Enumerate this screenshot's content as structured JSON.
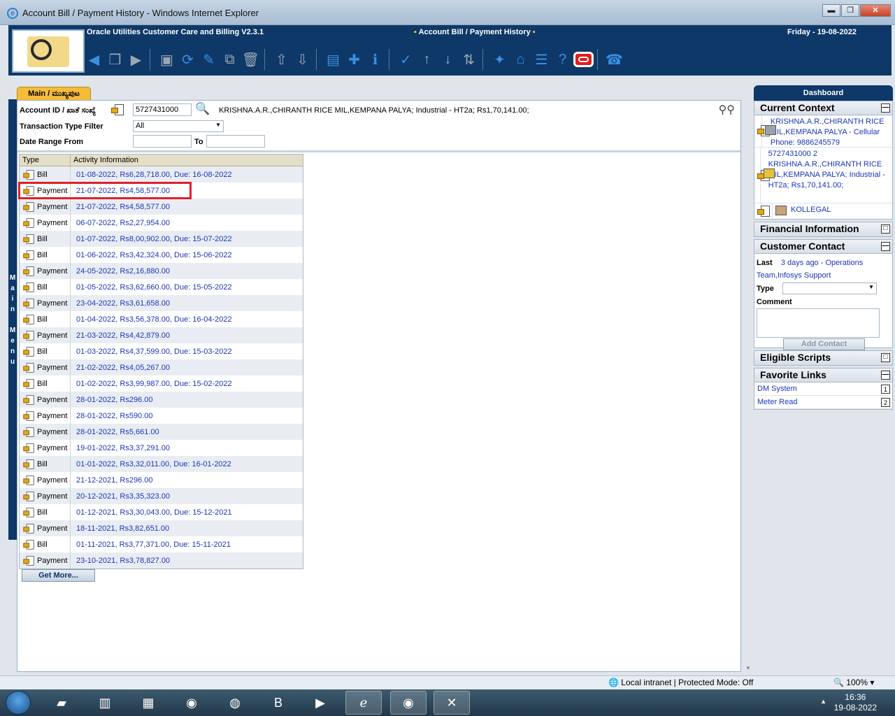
{
  "window": {
    "title": "Account Bill / Payment History - Windows Internet Explorer",
    "min": "▬",
    "max": "❐",
    "close": "✕"
  },
  "header": {
    "app_name": "Oracle Utilities Customer Care and Billing V2.3.1",
    "page_title": "Account Bill / Payment History",
    "date": "Friday - 19-08-2022"
  },
  "tab": {
    "label": "Main / ಮುಖ್ಯಪುಟ"
  },
  "side_menu": [
    "M",
    "a",
    "i",
    "n",
    "",
    "M",
    "e",
    "n",
    "u"
  ],
  "filters": {
    "account_label": "Account ID / ಖಾತೆ ಸಂಖ್ಯೆ",
    "account_value": "5727431000",
    "account_desc": "KRISHNA.A.R.,CHIRANTH RICE MIL,KEMPANA PALYA; Industrial - HT2a; Rs1,70,141.00;",
    "txn_filter_label": "Transaction Type Filter",
    "txn_filter_value": "All",
    "date_from_label": "Date Range From",
    "date_to_label": "To"
  },
  "grid": {
    "headers": [
      "Type",
      "Activity Information"
    ],
    "rows": [
      {
        "type": "Bill",
        "info": "01-08-2022, Rs6,28,718.00, Due: 16-08-2022"
      },
      {
        "type": "Payment",
        "info": "21-07-2022, Rs4,58,577.00"
      },
      {
        "type": "Payment",
        "info": "21-07-2022, Rs4,58,577.00"
      },
      {
        "type": "Payment",
        "info": "06-07-2022, Rs2,27,954.00"
      },
      {
        "type": "Bill",
        "info": "01-07-2022, Rs8,00,902.00, Due: 15-07-2022"
      },
      {
        "type": "Bill",
        "info": "01-06-2022, Rs3,42,324.00, Due: 15-06-2022"
      },
      {
        "type": "Payment",
        "info": "24-05-2022, Rs2,16,880.00"
      },
      {
        "type": "Bill",
        "info": "01-05-2022, Rs3,62,660.00, Due: 15-05-2022"
      },
      {
        "type": "Payment",
        "info": "23-04-2022, Rs3,61,658.00"
      },
      {
        "type": "Bill",
        "info": "01-04-2022, Rs3,56,378.00, Due: 16-04-2022"
      },
      {
        "type": "Payment",
        "info": "21-03-2022, Rs4,42,879.00"
      },
      {
        "type": "Bill",
        "info": "01-03-2022, Rs4,37,599.00, Due: 15-03-2022"
      },
      {
        "type": "Payment",
        "info": "21-02-2022, Rs4,05,267.00"
      },
      {
        "type": "Bill",
        "info": "01-02-2022, Rs3,99,987.00, Due: 15-02-2022"
      },
      {
        "type": "Payment",
        "info": "28-01-2022, Rs296.00"
      },
      {
        "type": "Payment",
        "info": "28-01-2022, Rs590.00"
      },
      {
        "type": "Payment",
        "info": "28-01-2022, Rs5,661.00"
      },
      {
        "type": "Payment",
        "info": "19-01-2022, Rs3,37,291.00"
      },
      {
        "type": "Bill",
        "info": "01-01-2022, Rs3,32,011.00, Due: 16-01-2022"
      },
      {
        "type": "Payment",
        "info": "21-12-2021, Rs296.00"
      },
      {
        "type": "Payment",
        "info": "20-12-2021, Rs3,35,323.00"
      },
      {
        "type": "Bill",
        "info": "01-12-2021, Rs3,30,043.00, Due: 15-12-2021"
      },
      {
        "type": "Payment",
        "info": "18-11-2021, Rs3,82,651.00"
      },
      {
        "type": "Bill",
        "info": "01-11-2021, Rs3,77,371.00, Due: 15-11-2021"
      },
      {
        "type": "Payment",
        "info": "23-10-2021, Rs3,78,827.00"
      }
    ],
    "get_more": "Get More..."
  },
  "dashboard": {
    "title": "Dashboard",
    "current_context": {
      "title": "Current Context",
      "person": "KRISHNA.A.R.,CHIRANTH RICE MIL,KEMPANA PALYA - Cellular Phone: 9886245579",
      "account": "5727431000 2 KRISHNA.A.R.,CHIRANTH RICE MIL,KEMPANA PALYA; Industrial - HT2a; Rs1,70,141.00;",
      "premise": "KOLLEGAL"
    },
    "financial_info": {
      "title": "Financial Information"
    },
    "customer_contact": {
      "title": "Customer Contact",
      "last_label": "Last",
      "last_value": "3 days ago - Operations Team,Infosys Support",
      "type_label": "Type",
      "comment_label": "Comment",
      "add_button": "Add Contact"
    },
    "eligible_scripts": {
      "title": "Eligible Scripts"
    },
    "favorite_links": {
      "title": "Favorite Links",
      "items": [
        {
          "label": "DM System",
          "num": "1"
        },
        {
          "label": "Meter Read",
          "num": "2"
        }
      ]
    }
  },
  "statusbar": {
    "zone": "Local intranet | Protected Mode: Off",
    "zoom": "100%"
  },
  "taskbar": {
    "time": "16:36",
    "date": "19-08-2022",
    "b_label": "B"
  },
  "colors": {
    "header_bg": "#0e3868",
    "tab": "#f5bb3a",
    "link": "#1a36b8",
    "highlight": "#e0202a"
  }
}
